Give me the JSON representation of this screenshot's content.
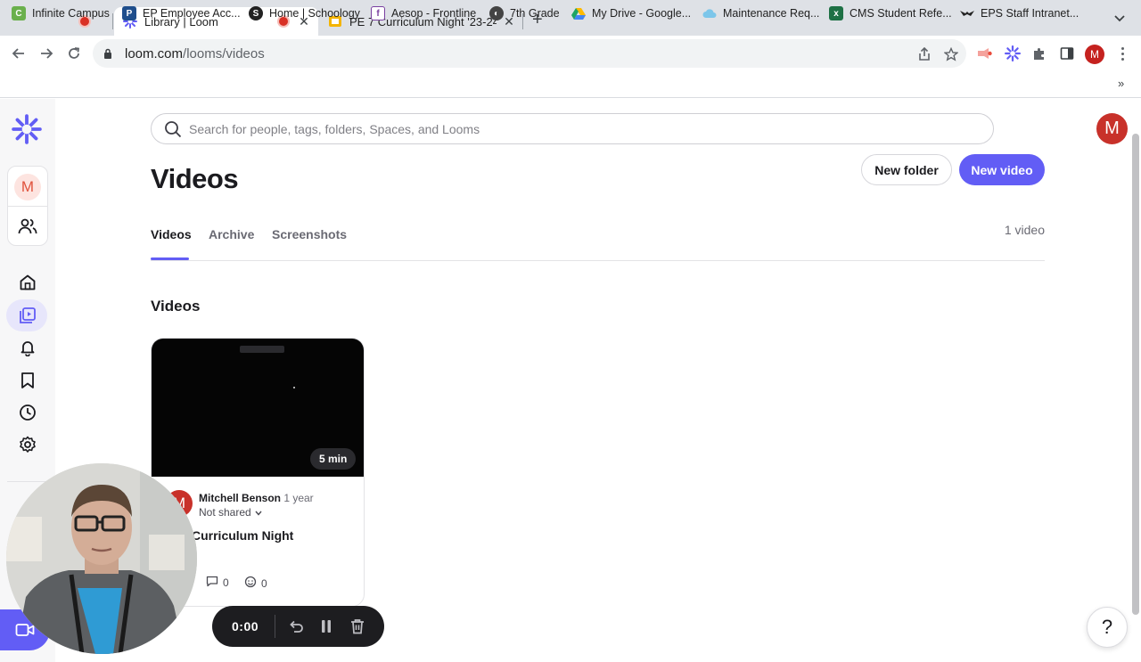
{
  "browser": {
    "tabs": [
      {
        "title": "",
        "recording": true
      },
      {
        "title": "Library | Loom",
        "recording": true,
        "active": true
      },
      {
        "title": "PE 7 Curriculum Night '23-24"
      }
    ],
    "url": {
      "host": "loom.com",
      "path": "/looms/videos"
    },
    "profile_initial": "M",
    "bookmarks": [
      {
        "label": "Infinite Campus",
        "icon": "campus-icon",
        "color": "#6ab04c"
      },
      {
        "label": "EP Employee Acc...",
        "icon": "ep-icon",
        "color": "#1f4e8c"
      },
      {
        "label": "Home | Schoology",
        "icon": "schoology-icon",
        "color": "#222222"
      },
      {
        "label": "Aesop - Frontline",
        "icon": "frontline-icon",
        "color": "#7a3fa0"
      },
      {
        "label": "7th Grade",
        "icon": "globe-icon",
        "color": "#444444"
      },
      {
        "label": "My Drive - Google...",
        "icon": "drive-icon",
        "color": "#1fa463"
      },
      {
        "label": "Maintenance Req...",
        "icon": "cloud-icon",
        "color": "#3aa0d8"
      },
      {
        "label": "CMS Student Refe...",
        "icon": "excel-icon",
        "color": "#1e7145"
      },
      {
        "label": "EPS Staff Intranet...",
        "icon": "eagle-icon",
        "color": "#222222"
      }
    ],
    "bookmarks_more": "»"
  },
  "app": {
    "sidebar_workspace_initial": "M",
    "user_initial": "M",
    "search_placeholder": "Search for people, tags, folders, Spaces, and Looms",
    "page_title": "Videos",
    "new_folder_label": "New folder",
    "new_video_label": "New video",
    "tabs": [
      {
        "label": "Videos",
        "active": true
      },
      {
        "label": "Archive"
      },
      {
        "label": "Screenshots"
      }
    ],
    "video_count": "1 video",
    "section_title": "Videos",
    "accent_color": "#625df5"
  },
  "video_card": {
    "duration": "5 min",
    "author_initial": "M",
    "author": "Mitchell Benson",
    "time_ago": "· 1 year",
    "share_status": "Not shared",
    "title": "Curriculum Night",
    "comments": "0",
    "reactions": "0"
  },
  "recorder": {
    "time": "0:00"
  },
  "help_label": "?"
}
